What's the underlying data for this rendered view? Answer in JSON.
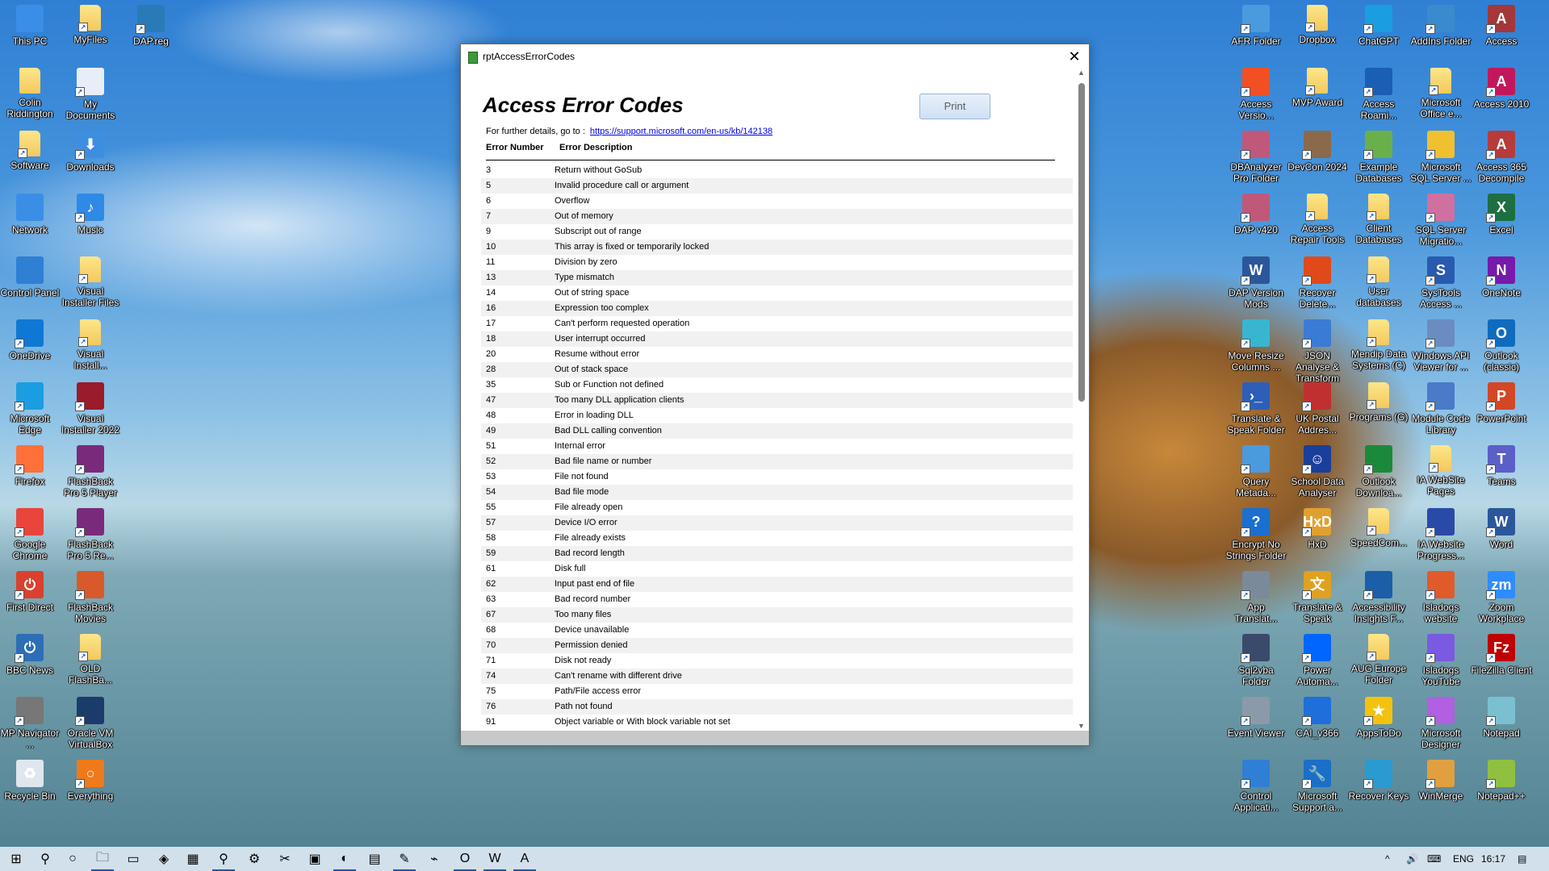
{
  "desktop": {
    "left_icons": [
      {
        "label": "This PC",
        "icon": "computer-icon",
        "col": 0,
        "row": 0
      },
      {
        "label": "MyFiles",
        "icon": "folder-icon",
        "col": 1,
        "row": 0
      },
      {
        "label": "DAP.reg",
        "icon": "registry-file-icon",
        "col": 2,
        "row": 0
      },
      {
        "label": "Colin Riddington",
        "icon": "user-folder-icon",
        "col": 0,
        "row": 1
      },
      {
        "label": "My Documents",
        "icon": "document-icon",
        "col": 1,
        "row": 1
      },
      {
        "label": "Software",
        "icon": "folder-icon",
        "col": 0,
        "row": 2
      },
      {
        "label": "Downloads",
        "icon": "download-arrow-icon",
        "col": 1,
        "row": 2
      },
      {
        "label": "Network",
        "icon": "network-icon",
        "col": 0,
        "row": 3
      },
      {
        "label": "Music",
        "icon": "music-note-icon",
        "col": 1,
        "row": 3
      },
      {
        "label": "Control Panel",
        "icon": "control-panel-icon",
        "col": 0,
        "row": 4
      },
      {
        "label": "Visual Installer Files",
        "icon": "folder-icon",
        "col": 1,
        "row": 4
      },
      {
        "label": "OneDrive",
        "icon": "cloud-icon",
        "col": 0,
        "row": 5
      },
      {
        "label": "Visual Install...",
        "icon": "folder-icon",
        "col": 1,
        "row": 5
      },
      {
        "label": "Microsoft Edge",
        "icon": "edge-icon",
        "col": 0,
        "row": 6
      },
      {
        "label": "Visual Installer 2022",
        "icon": "installer-icon",
        "col": 1,
        "row": 6
      },
      {
        "label": "Firefox",
        "icon": "firefox-icon",
        "col": 0,
        "row": 7
      },
      {
        "label": "FlashBack Pro 5 Player",
        "icon": "flashback-player-icon",
        "col": 1,
        "row": 7
      },
      {
        "label": "Google Chrome",
        "icon": "chrome-icon",
        "col": 0,
        "row": 8
      },
      {
        "label": "FlashBack Pro 5 Re...",
        "icon": "flashback-recorder-icon",
        "col": 1,
        "row": 8
      },
      {
        "label": "First Direct",
        "icon": "first-direct-icon",
        "col": 0,
        "row": 9
      },
      {
        "label": "FlashBack Movies",
        "icon": "flashback-movies-icon",
        "col": 1,
        "row": 9
      },
      {
        "label": "BBC News",
        "icon": "power-icon",
        "col": 0,
        "row": 10
      },
      {
        "label": "OLD FlashBa...",
        "icon": "folder-icon",
        "col": 1,
        "row": 10
      },
      {
        "label": "MP Navigator ...",
        "icon": "scanner-icon",
        "col": 0,
        "row": 11
      },
      {
        "label": "Oracle VM VirtualBox",
        "icon": "virtualbox-icon",
        "col": 1,
        "row": 11
      },
      {
        "label": "Recycle Bin",
        "icon": "recycle-bin-icon",
        "col": 0,
        "row": 12
      },
      {
        "label": "Everything",
        "icon": "magnifier-icon",
        "col": 1,
        "row": 12
      }
    ],
    "right_icons": [
      {
        "label": "AFR Folder",
        "icon": "window-icon",
        "col": 0,
        "row": 0
      },
      {
        "label": "Dropbox",
        "icon": "folder-icon",
        "col": 1,
        "row": 0
      },
      {
        "label": "ChatGPT",
        "icon": "edge-icon",
        "col": 2,
        "row": 0
      },
      {
        "label": "AddIns Folder",
        "icon": "calendar-icon",
        "col": 3,
        "row": 0
      },
      {
        "label": "Access",
        "icon": "access-icon",
        "col": 4,
        "row": 0
      },
      {
        "label": "Access Versio...",
        "icon": "shield-icon",
        "col": 0,
        "row": 1
      },
      {
        "label": "MVP Award",
        "icon": "folder-icon",
        "col": 1,
        "row": 1
      },
      {
        "label": "Access Roami...",
        "icon": "shield-blue-icon",
        "col": 2,
        "row": 1
      },
      {
        "label": "Microsoft Office e...",
        "icon": "folder-icon",
        "col": 3,
        "row": 1
      },
      {
        "label": "Access 2010",
        "icon": "access-2010-icon",
        "col": 4,
        "row": 1
      },
      {
        "label": "DBAnalyzer Pro Folder",
        "icon": "database-icon",
        "col": 0,
        "row": 2
      },
      {
        "label": "DevCon 2024",
        "icon": "people-icon",
        "col": 1,
        "row": 2
      },
      {
        "label": "Example Databases",
        "icon": "picture-icon",
        "col": 2,
        "row": 2
      },
      {
        "label": "Microsoft SQL Server ...",
        "icon": "sql-server-icon",
        "col": 3,
        "row": 2
      },
      {
        "label": "Access 365 Decompile",
        "icon": "access-wand-icon",
        "col": 4,
        "row": 2
      },
      {
        "label": "DAP v420",
        "icon": "database-icon",
        "col": 0,
        "row": 3
      },
      {
        "label": "Access Repair Tools",
        "icon": "folder-open-icon",
        "col": 1,
        "row": 3
      },
      {
        "label": "Client Databases",
        "icon": "folder-icon",
        "col": 2,
        "row": 3
      },
      {
        "label": "SQL Server Migratio...",
        "icon": "migration-icon",
        "col": 3,
        "row": 3
      },
      {
        "label": "Excel",
        "icon": "excel-icon",
        "col": 4,
        "row": 3
      },
      {
        "label": "DAP Version Mods",
        "icon": "word-doc-icon",
        "col": 0,
        "row": 4
      },
      {
        "label": "Recover Delete...",
        "icon": "recover-icon",
        "col": 1,
        "row": 4
      },
      {
        "label": "User databases",
        "icon": "folder-icon",
        "col": 2,
        "row": 4
      },
      {
        "label": "SysTools Access ...",
        "icon": "systools-icon",
        "col": 3,
        "row": 4
      },
      {
        "label": "OneNote",
        "icon": "onenote-icon",
        "col": 4,
        "row": 4
      },
      {
        "label": "Move Resize Columns ...",
        "icon": "cube-icon",
        "col": 0,
        "row": 5
      },
      {
        "label": "JSON Analyse & Transform",
        "icon": "globe-download-icon",
        "col": 1,
        "row": 5
      },
      {
        "label": "Mendip Data Systems (C)",
        "icon": "folder-icon",
        "col": 2,
        "row": 5
      },
      {
        "label": "Windows API Viewer for ...",
        "icon": "api-viewer-icon",
        "col": 3,
        "row": 5
      },
      {
        "label": "Outlook (classic)",
        "icon": "outlook-icon",
        "col": 4,
        "row": 5
      },
      {
        "label": "Translate & Speak Folder",
        "icon": "powershell-icon",
        "col": 0,
        "row": 6
      },
      {
        "label": "UK Postal Addres...",
        "icon": "house-icon",
        "col": 1,
        "row": 6
      },
      {
        "label": "Programs (G)",
        "icon": "folder-icon",
        "col": 2,
        "row": 6
      },
      {
        "label": "Module Code Library",
        "icon": "code-library-icon",
        "col": 3,
        "row": 6
      },
      {
        "label": "PowerPoint",
        "icon": "powerpoint-icon",
        "col": 4,
        "row": 6
      },
      {
        "label": "Query Metada...",
        "icon": "query-icon",
        "col": 0,
        "row": 7
      },
      {
        "label": "School Data Analyser",
        "icon": "accessibility-icon",
        "col": 1,
        "row": 7
      },
      {
        "label": "Outlook Downloa...",
        "icon": "check-window-icon",
        "col": 2,
        "row": 7
      },
      {
        "label": "IA WebSite Pages",
        "icon": "folder-icon",
        "col": 3,
        "row": 7
      },
      {
        "label": "Teams",
        "icon": "teams-icon",
        "col": 4,
        "row": 7
      },
      {
        "label": "Encrypt No Strings Folder",
        "icon": "help-shield-icon",
        "col": 0,
        "row": 8
      },
      {
        "label": "HxD",
        "icon": "hxd-icon",
        "col": 1,
        "row": 8
      },
      {
        "label": "SpeedCom...",
        "icon": "folder-icon",
        "col": 2,
        "row": 8
      },
      {
        "label": "IA Website Progress...",
        "icon": "expand-icon",
        "col": 3,
        "row": 8
      },
      {
        "label": "Word",
        "icon": "word-icon",
        "col": 4,
        "row": 8
      },
      {
        "label": "App Translat...",
        "icon": "clock-window-icon",
        "col": 0,
        "row": 9
      },
      {
        "label": "Translate & Speak",
        "icon": "translate-icon",
        "col": 1,
        "row": 9
      },
      {
        "label": "Accessibility Insights F...",
        "icon": "heart-search-icon",
        "col": 2,
        "row": 9
      },
      {
        "label": "Isladogs website",
        "icon": "butterfly-icon",
        "col": 3,
        "row": 9
      },
      {
        "label": "Zoom Workplace",
        "icon": "zoom-icon",
        "col": 4,
        "row": 9
      },
      {
        "label": "Sql2vba Folder",
        "icon": "sql2vba-icon",
        "col": 0,
        "row": 10
      },
      {
        "label": "Power Automa...",
        "icon": "power-automate-icon",
        "col": 1,
        "row": 10
      },
      {
        "label": "AUG Europe Folder",
        "icon": "folder-doc-icon",
        "col": 2,
        "row": 10
      },
      {
        "label": "Isladogs YouTube",
        "icon": "monitor-icon",
        "col": 3,
        "row": 10
      },
      {
        "label": "FileZilla Client",
        "icon": "filezilla-icon",
        "col": 4,
        "row": 10
      },
      {
        "label": "Event Viewer",
        "icon": "event-viewer-icon",
        "col": 0,
        "row": 11
      },
      {
        "label": "CAI_v366",
        "icon": "flame-icon",
        "col": 1,
        "row": 11
      },
      {
        "label": "AppsToDo",
        "icon": "star-icon",
        "col": 2,
        "row": 11
      },
      {
        "label": "Microsoft Designer",
        "icon": "designer-icon",
        "col": 3,
        "row": 11
      },
      {
        "label": "Notepad",
        "icon": "notepad-icon",
        "col": 4,
        "row": 11
      },
      {
        "label": "Control Applicati...",
        "icon": "control-panel-icon",
        "col": 0,
        "row": 12
      },
      {
        "label": "Microsoft Support a...",
        "icon": "wrench-icon",
        "col": 1,
        "row": 12
      },
      {
        "label": "Recover Keys",
        "icon": "key-shield-icon",
        "col": 2,
        "row": 12
      },
      {
        "label": "WinMerge",
        "icon": "winmerge-icon",
        "col": 3,
        "row": 12
      },
      {
        "label": "Notepad++",
        "icon": "notepadpp-icon",
        "col": 4,
        "row": 12
      }
    ]
  },
  "dialog": {
    "window_title": "rptAccessErrorCodes",
    "close_glyph": "✕",
    "report_title": "Access Error Codes",
    "print_label": "Print",
    "details_text": "For further details, go to :",
    "details_link": "https://support.microsoft.com/en-us/kb/142138",
    "col_number": "Error Number",
    "col_description": "Error Description",
    "rows": [
      {
        "num": "3",
        "desc": "Return without GoSub"
      },
      {
        "num": "5",
        "desc": "Invalid procedure call or argument"
      },
      {
        "num": "6",
        "desc": "Overflow"
      },
      {
        "num": "7",
        "desc": "Out of memory"
      },
      {
        "num": "9",
        "desc": "Subscript out of range"
      },
      {
        "num": "10",
        "desc": "This array is fixed or temporarily locked"
      },
      {
        "num": "11",
        "desc": "Division by zero"
      },
      {
        "num": "13",
        "desc": "Type mismatch"
      },
      {
        "num": "14",
        "desc": "Out of string space"
      },
      {
        "num": "16",
        "desc": "Expression too complex"
      },
      {
        "num": "17",
        "desc": "Can't perform requested operation"
      },
      {
        "num": "18",
        "desc": "User interrupt occurred"
      },
      {
        "num": "20",
        "desc": "Resume without error"
      },
      {
        "num": "28",
        "desc": "Out of stack space"
      },
      {
        "num": "35",
        "desc": "Sub or Function not defined"
      },
      {
        "num": "47",
        "desc": "Too many DLL application clients"
      },
      {
        "num": "48",
        "desc": "Error in loading DLL"
      },
      {
        "num": "49",
        "desc": "Bad DLL calling convention"
      },
      {
        "num": "51",
        "desc": "Internal error"
      },
      {
        "num": "52",
        "desc": "Bad file name or number"
      },
      {
        "num": "53",
        "desc": "File not found"
      },
      {
        "num": "54",
        "desc": "Bad file mode"
      },
      {
        "num": "55",
        "desc": "File already open"
      },
      {
        "num": "57",
        "desc": "Device I/O error"
      },
      {
        "num": "58",
        "desc": "File already exists"
      },
      {
        "num": "59",
        "desc": "Bad record length"
      },
      {
        "num": "61",
        "desc": "Disk full"
      },
      {
        "num": "62",
        "desc": "Input past end of file"
      },
      {
        "num": "63",
        "desc": "Bad record number"
      },
      {
        "num": "67",
        "desc": "Too many files"
      },
      {
        "num": "68",
        "desc": "Device unavailable"
      },
      {
        "num": "70",
        "desc": "Permission denied"
      },
      {
        "num": "71",
        "desc": "Disk not ready"
      },
      {
        "num": "74",
        "desc": "Can't rename with different drive"
      },
      {
        "num": "75",
        "desc": "Path/File access error"
      },
      {
        "num": "76",
        "desc": "Path not found"
      },
      {
        "num": "91",
        "desc": "Object variable or With block variable not set"
      }
    ]
  },
  "taskbar": {
    "items": [
      {
        "name": "start-button",
        "glyph": "⊞",
        "active": false
      },
      {
        "name": "search-button",
        "glyph": "⚲",
        "active": false
      },
      {
        "name": "cortana-button",
        "glyph": "○",
        "active": false
      },
      {
        "name": "file-explorer-taskbar",
        "glyph": "🗀",
        "active": true
      },
      {
        "name": "command-prompt-taskbar",
        "glyph": "▭",
        "active": false
      },
      {
        "name": "copilot-taskbar",
        "glyph": "◈",
        "active": false
      },
      {
        "name": "calculator-taskbar",
        "glyph": "▦",
        "active": false
      },
      {
        "name": "everything-taskbar",
        "glyph": "⚲",
        "active": true
      },
      {
        "name": "settings-taskbar",
        "glyph": "⚙",
        "active": false
      },
      {
        "name": "snipping-tool-taskbar",
        "glyph": "✂",
        "active": false
      },
      {
        "name": "flashback-taskbar",
        "glyph": "▣",
        "active": false
      },
      {
        "name": "edge-taskbar",
        "glyph": "◐",
        "active": true
      },
      {
        "name": "notepad-taskbar",
        "glyph": "▤",
        "active": false
      },
      {
        "name": "notepadpp-taskbar",
        "glyph": "✎",
        "active": true
      },
      {
        "name": "resource-monitor-taskbar",
        "glyph": "⌁",
        "active": false
      },
      {
        "name": "outlook-taskbar",
        "glyph": "O",
        "active": true
      },
      {
        "name": "word-taskbar",
        "glyph": "W",
        "active": true
      },
      {
        "name": "access-taskbar",
        "glyph": "A",
        "active": true
      }
    ],
    "tray": {
      "chevron": "^",
      "volume": "🔊",
      "keyboard": "⌨",
      "language": "ENG",
      "time": "16:17",
      "notifications": "▤"
    }
  },
  "colors": {
    "link": "#0000ee",
    "row_alt": "#f1f1f1",
    "print_button_bg": "#dce8f7",
    "taskbar_active": "#1f5aa6"
  }
}
